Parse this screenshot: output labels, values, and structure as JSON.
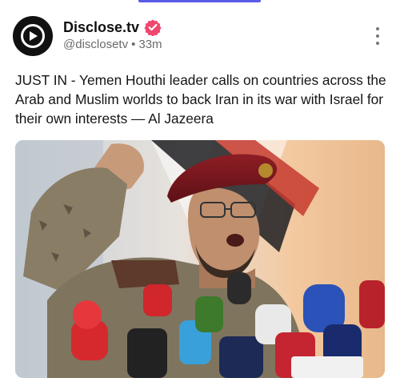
{
  "post": {
    "author_name": "Disclose.tv",
    "handle": "@disclosetv",
    "separator": "•",
    "time": "33m",
    "text": "JUST IN - Yemen Houthi leader calls on countries across the Arab and Muslim worlds to back Iran in its war with Israel for their own interests — Al Jazeera"
  },
  "icons": {
    "avatar": "play-logo-icon",
    "verified": "verified-badge-icon",
    "more": "more-vertical-icon"
  },
  "colors": {
    "accent": "#5b5be8",
    "verified": "#f0466e",
    "text": "#151515",
    "secondary": "#6b6b6b"
  }
}
